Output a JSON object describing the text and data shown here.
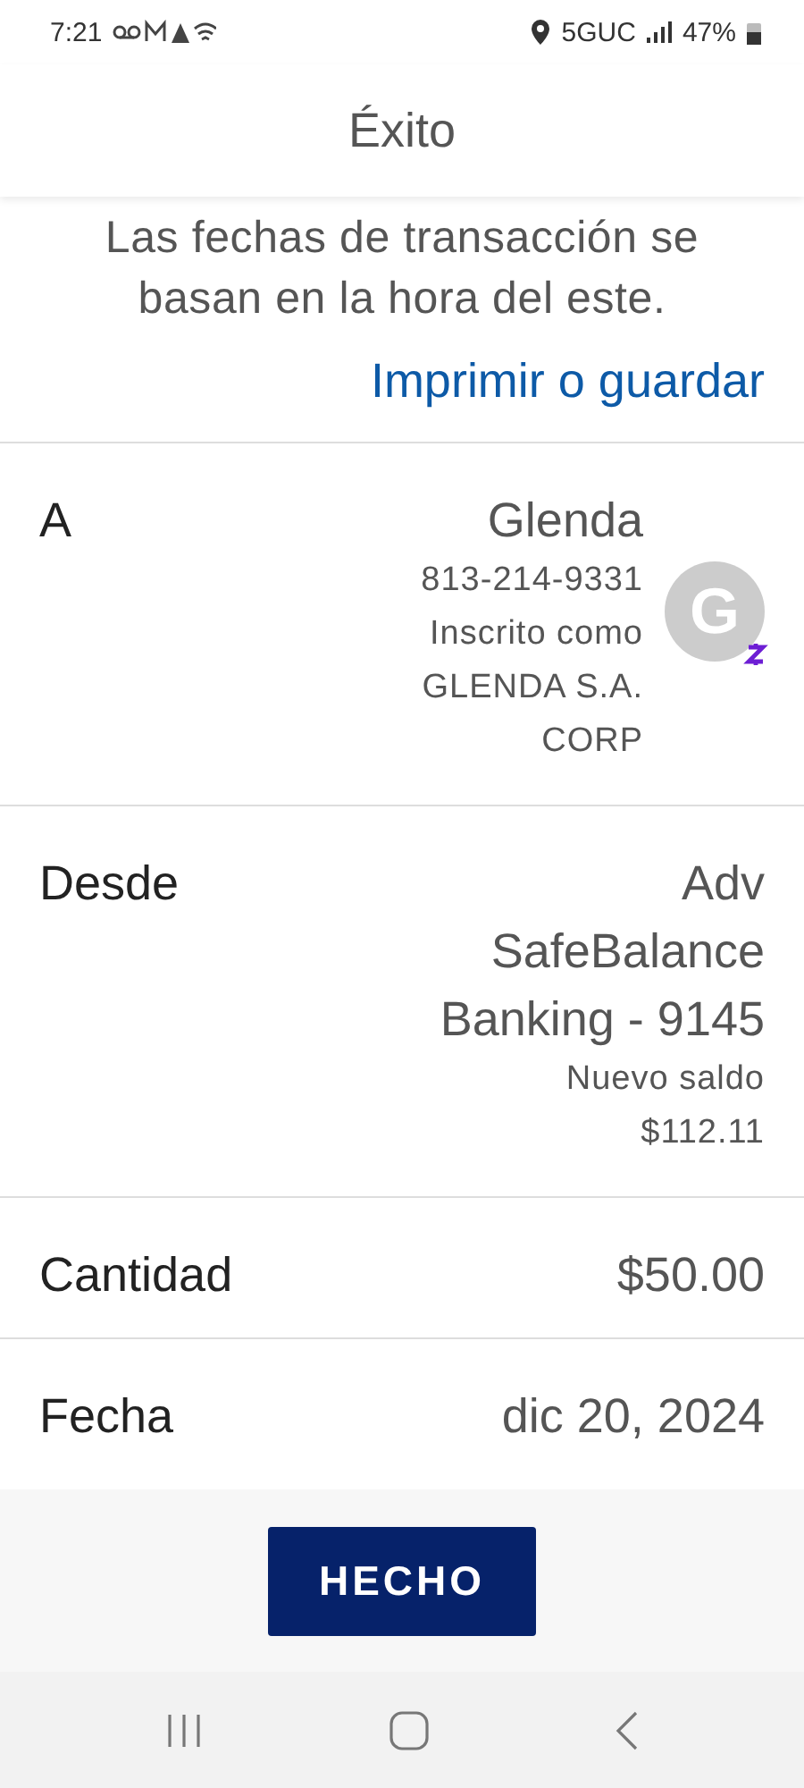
{
  "status_bar": {
    "time": "7:21",
    "network": "5GUC",
    "battery": "47%"
  },
  "header": {
    "title": "Éxito"
  },
  "notice": "Las fechas de transacción se basan en la hora del este.",
  "print_link": "Imprimir o guardar",
  "details": [
    {
      "kind": "recipient",
      "label": "A",
      "name": "Glenda",
      "phone": "813-214-9331",
      "enrolled": "Inscrito como GLENDA S.A. CORP",
      "initial": "G"
    },
    {
      "kind": "account",
      "label": "Desde",
      "value": "Adv SafeBalance Banking - 9145",
      "note": "Nuevo saldo $112.11"
    },
    {
      "kind": "simple",
      "label": "Cantidad",
      "value": "$50.00"
    },
    {
      "kind": "simple",
      "label": "Fecha",
      "value": "dic 20, 2024"
    }
  ],
  "done_button": "HECHO"
}
